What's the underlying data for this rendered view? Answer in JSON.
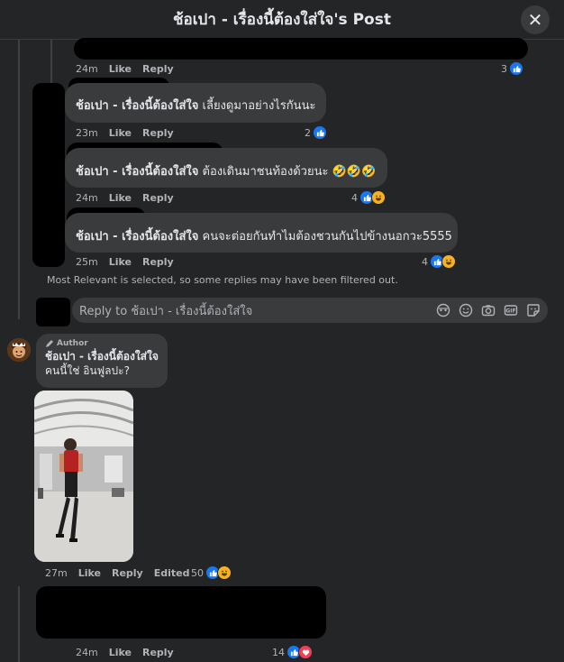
{
  "header": {
    "title": "ช้อเปา - เรื่องนี้ต้องใส่ใจ's Post",
    "close_icon": "close-icon"
  },
  "comments": [
    {
      "time": "24m",
      "like": "Like",
      "reply": "Reply",
      "count": "3"
    },
    {
      "author": "ช้อเปา - เรื่องนี้ต้องใส่ใจ",
      "text": "เลี้ยงดูมาอย่างไรกันนะ",
      "time": "23m",
      "like": "Like",
      "reply": "Reply",
      "count": "2"
    },
    {
      "author": "ช้อเปา - เรื่องนี้ต้องใส่ใจ",
      "text": "ต้องเดินมาชนท้องด้วยนะ 🤣🤣🤣",
      "time": "24m",
      "like": "Like",
      "reply": "Reply",
      "count": "4"
    },
    {
      "author": "ช้อเปา - เรื่องนี้ต้องใส่ใจ",
      "text": "คนจะต่อยกันทำไมต้องชวนกันไปข้างนอกวะ5555",
      "time": "25m",
      "like": "Like",
      "reply": "Reply",
      "count": "4"
    }
  ],
  "filter_note": "Most Relevant is selected, so some replies may have been filtered out.",
  "reply_box": {
    "placeholder": "Reply to ช้อเปา - เรื่องนี้ต้องใส่ใจ"
  },
  "author_comment": {
    "tag": "Author",
    "name": "ช้อเปา - เรื่องนี้ต้องใส่ใจ",
    "text": "คนนี้ใช่ อินฟูลปะ?",
    "time": "27m",
    "like": "Like",
    "reply": "Reply",
    "edited": "Edited",
    "count": "50"
  },
  "last_comment": {
    "time": "24m",
    "like": "Like",
    "reply": "Reply",
    "count": "14"
  },
  "colors": {
    "like_blue": "#1877f2",
    "haha_yellow": "#f7b125",
    "love_red": "#f33e58",
    "bubble": "#3a3b3c",
    "background": "#242526"
  }
}
